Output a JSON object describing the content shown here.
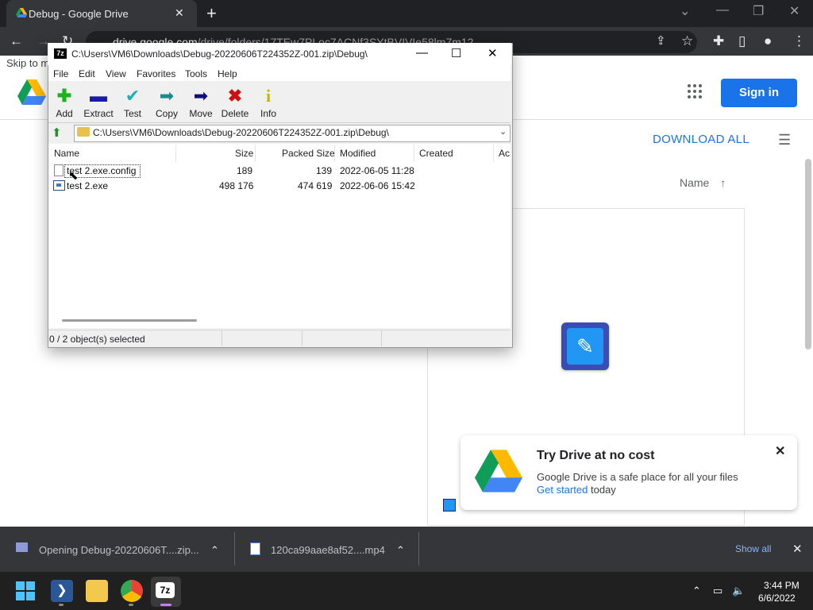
{
  "browser": {
    "tab_title": "Debug - Google Drive",
    "url_host": "drive.google.com",
    "url_path": "/drive/folders/17TEw7PLoc7ACNf3SYtBVIVIe58lm7m12"
  },
  "drive": {
    "skip_link": "Skip to m",
    "sign_in": "Sign in",
    "download_all": "DOWNLOAD ALL",
    "sort_label": "Name",
    "promo": {
      "title": "Try Drive at no cost",
      "text": "Google Drive is a safe place for all your files",
      "link": "Get started",
      "after_link": "today"
    }
  },
  "sevenzip": {
    "title": "C:\\Users\\VM6\\Downloads\\Debug-20220606T224352Z-001.zip\\Debug\\",
    "logo": "7z",
    "menu": [
      "File",
      "Edit",
      "View",
      "Favorites",
      "Tools",
      "Help"
    ],
    "tools": [
      {
        "label": "Add",
        "icon": "add-icon",
        "color": "#1bb31b"
      },
      {
        "label": "Extract",
        "icon": "extract-icon",
        "color": "#1a1aa8"
      },
      {
        "label": "Test",
        "icon": "test-icon",
        "color": "#20b0b0"
      },
      {
        "label": "Copy",
        "icon": "copy-icon",
        "color": "#1c8a8a"
      },
      {
        "label": "Move",
        "icon": "move-icon",
        "color": "#10107a"
      },
      {
        "label": "Delete",
        "icon": "delete-icon",
        "color": "#d01010"
      },
      {
        "label": "Info",
        "icon": "info-icon",
        "color": "#c8b800"
      }
    ],
    "address": "C:\\Users\\VM6\\Downloads\\Debug-20220606T224352Z-001.zip\\Debug\\",
    "columns": [
      "Name",
      "Size",
      "Packed Size",
      "Modified",
      "Created",
      "Ac"
    ],
    "files": [
      {
        "name": "test 2.exe.config",
        "size": "189",
        "packed": "139",
        "modified": "2022-06-05 11:28"
      },
      {
        "name": "test 2.exe",
        "size": "498 176",
        "packed": "474 619",
        "modified": "2022-06-06 15:42"
      }
    ],
    "status": "0 / 2 object(s) selected"
  },
  "downloads": {
    "item1": "Opening Debug-20220606T....zip...",
    "item2": "120ca99aae8af52....mp4",
    "show_all": "Show all"
  },
  "taskbar": {
    "time": "3:44 PM",
    "date": "6/6/2022"
  }
}
